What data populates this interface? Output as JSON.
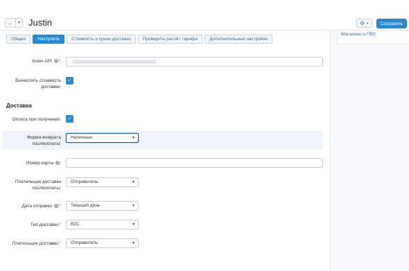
{
  "header": {
    "title": "Justin",
    "back_icon": "arrow-left-icon",
    "dropdown_icon": "caret-down-icon",
    "settings_icon": "gear-icon",
    "save_label": "Сохранить"
  },
  "tabs": [
    {
      "label": "Общее",
      "active": false
    },
    {
      "label": "Настроить",
      "active": true
    },
    {
      "label": "Стоимость и сроки доставки",
      "active": false
    },
    {
      "label": "Проверить расчёт тарифа",
      "active": false
    },
    {
      "label": "Дополнительные настройки",
      "active": false
    }
  ],
  "sidebar": {
    "link": "Магазины и ПВЗ"
  },
  "form": {
    "api_key": {
      "label": "Ключ API",
      "required_mark": "*"
    },
    "calc_cost": {
      "label": "Вычислять стоимость доставки:",
      "checked": true
    },
    "section_title": "Доставка",
    "cod": {
      "label": "Оплата при получении:",
      "checked": true
    },
    "return_form": {
      "label": "Форма возврата послеоплаты:",
      "value": "Наличные"
    },
    "card_number": {
      "label": "Номер карты",
      "value": ""
    },
    "cod_payer": {
      "label": "Плательщик доставки послеоплаты:",
      "value": "Отправитель"
    },
    "ship_date": {
      "label": "Дата отправки",
      "required_mark": "*",
      "value": "Текущий день"
    },
    "delivery_type": {
      "label": "Тип доставки:",
      "required_mark": "*",
      "value": "B2C"
    },
    "delivery_payer": {
      "label": "Плательщик доставки:",
      "required_mark": "*",
      "value": "Отправитель"
    }
  },
  "colors": {
    "primary": "#2a8ad1",
    "link": "#2f6fa5",
    "required": "#d9534f"
  }
}
